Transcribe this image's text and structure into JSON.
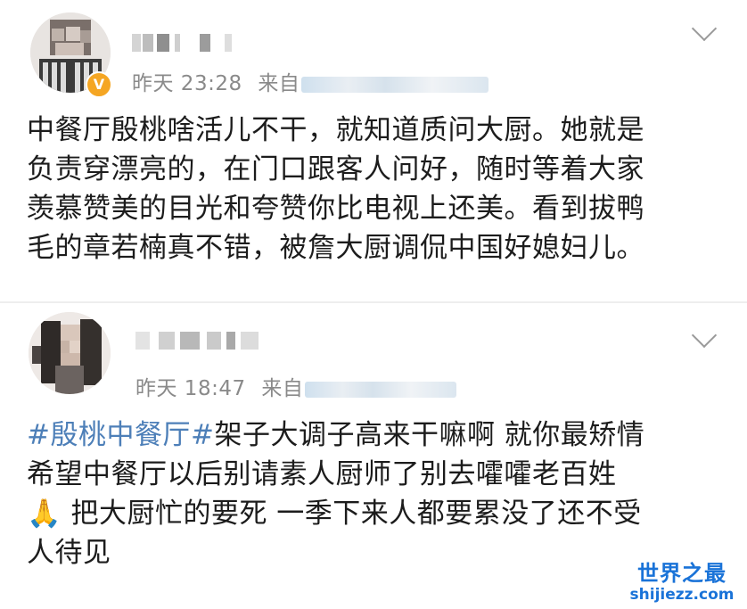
{
  "posts": [
    {
      "time": "昨天 23:28",
      "source_prefix": "来自",
      "verified_badge": "V",
      "content": "中餐厅殷桃啥活儿不干，就知道质问大厨。她就是\n负责穿漂亮的，在门口跟客人问好，随时等着大家\n羡慕赞美的目光和夸赞你比电视上还美。看到拔鸭\n毛的章若楠真不错，被詹大厨调侃中国好媳妇儿。",
      "icons": {
        "more": "chevron-down-icon",
        "verified": "verified-badge-icon"
      }
    },
    {
      "time": "昨天 18:47",
      "source_prefix": "来自",
      "hashtag": "#殷桃中餐厅#",
      "content": "架子大调子高来干嘛啊 就你最矫情\n希望中餐厅以后别请素人厨师了别去嚯嚯老百姓\n🙏 把大厨忙的要死 一季下来人都要累没了还不受\n人待见",
      "icons": {
        "more": "chevron-down-icon"
      }
    }
  ],
  "watermark": {
    "title": "世界之最",
    "url": "shijiezz.com"
  },
  "colors": {
    "hashtag": "#4d7fb8",
    "meta_text": "#8a8a8a",
    "watermark": "#1a73d8",
    "verified": "#f5a623"
  }
}
